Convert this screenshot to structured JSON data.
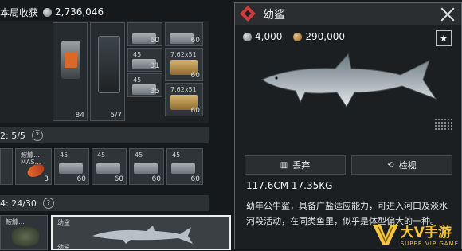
{
  "header": {
    "title": "本局收获",
    "value": "2,736,046"
  },
  "inventory": {
    "slot_counts": [
      "60",
      "60",
      "60",
      "31",
      "60",
      "35",
      "60"
    ],
    "calibers": [
      "45",
      "7.62x51",
      "45",
      "7.62x51"
    ],
    "special_counts": [
      "84",
      "5/7"
    ],
    "section1": {
      "label": "2: 5/5",
      "help": "?"
    },
    "row_items": [
      {
        "caption": "鮟鱇…",
        "sub": "MAS…",
        "count": "3"
      },
      {
        "caption": "45",
        "sub": "",
        "count": "60"
      },
      {
        "caption": "45",
        "sub": "",
        "count": "60"
      },
      {
        "caption": "45",
        "sub": "",
        "count": "60"
      },
      {
        "caption": "45",
        "sub": "",
        "count": "60"
      }
    ],
    "section2": {
      "label": "4: 24/30",
      "help": "?"
    },
    "bottom_left_label": "鮟鱇…",
    "bottom_selected_label": "幼鲨",
    "bottom_selected_label2": "幼鲨"
  },
  "detail": {
    "title": "幼鲨",
    "price_silver": "4,000",
    "price_gold": "290,000",
    "star_glyph": "★",
    "discard_label": "丢弃",
    "inspect_label": "检视",
    "stats": "117.6CM  17.35KG",
    "description": "幼年公牛鲨，具备广盐适应能力，可进入河口及淡水河段活动，在同类鱼里，似乎是体型偏大的一种。"
  },
  "watermark": {
    "main": "大V手游",
    "sub": "SUPER VIP GAME"
  },
  "colors": {
    "accent_red": "#d23a3a",
    "gold": "#f6c640"
  }
}
